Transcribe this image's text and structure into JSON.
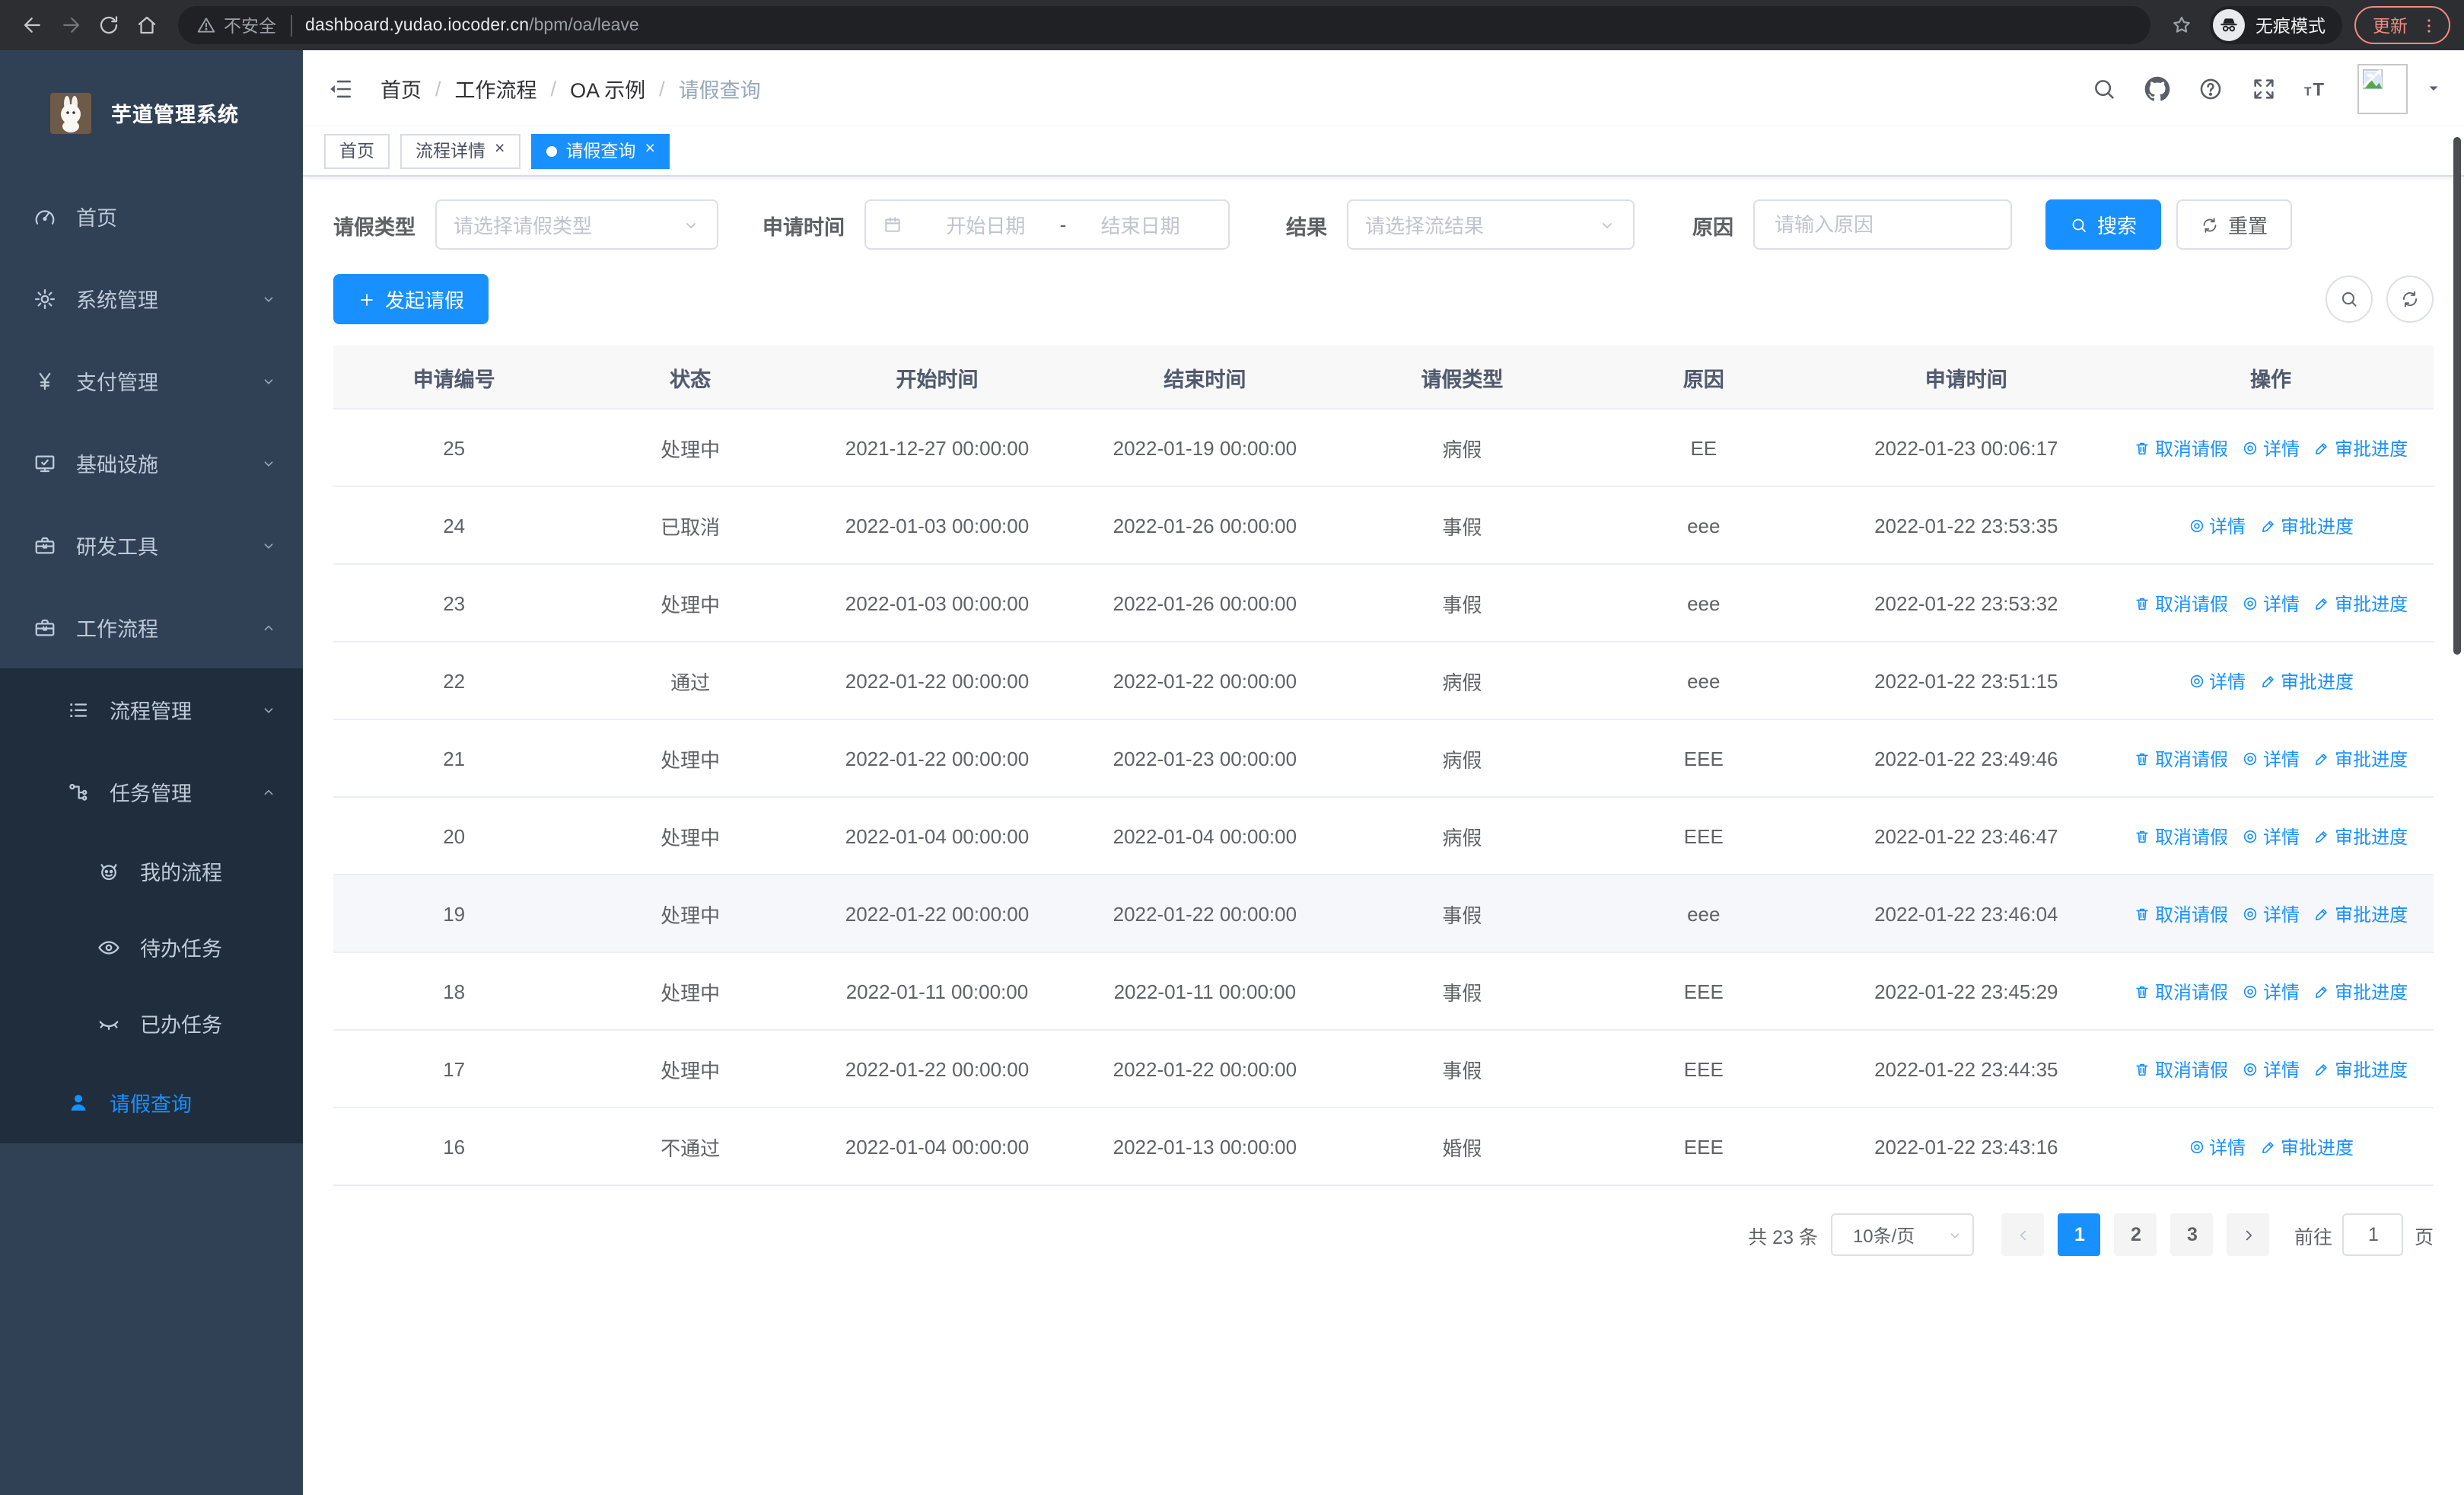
{
  "colors": {
    "primary": "#1890ff",
    "sidebar_bg": "#304156",
    "sidebar_submenu_bg": "#1f2d3d",
    "update_accent": "#f28b82"
  },
  "browser": {
    "security_label": "不安全",
    "url_host": "dashboard.yudao.iocoder.cn",
    "url_path": "/bpm/oa/leave",
    "incognito_label": "无痕模式",
    "update_label": "更新"
  },
  "sidebar": {
    "title": "芋道管理系统",
    "items": [
      {
        "label": "首页",
        "icon": "gauge",
        "level": 0
      },
      {
        "label": "系统管理",
        "icon": "gear",
        "level": 0,
        "chevron": "down"
      },
      {
        "label": "支付管理",
        "icon": "yen",
        "level": 0,
        "chevron": "down"
      },
      {
        "label": "基础设施",
        "icon": "monitor",
        "level": 0,
        "chevron": "down"
      },
      {
        "label": "研发工具",
        "icon": "toolbox",
        "level": 0,
        "chevron": "down"
      },
      {
        "label": "工作流程",
        "icon": "toolbox",
        "level": 0,
        "chevron": "up"
      },
      {
        "label": "流程管理",
        "icon": "list",
        "level": 1,
        "chevron": "down",
        "sub": true
      },
      {
        "label": "任务管理",
        "icon": "flow",
        "level": 1,
        "chevron": "up",
        "sub": true
      },
      {
        "label": "我的流程",
        "icon": "robot",
        "level": 2,
        "sub": true
      },
      {
        "label": "待办任务",
        "icon": "eye",
        "level": 2,
        "sub": true
      },
      {
        "label": "已办任务",
        "icon": "eye-closed",
        "level": 2,
        "sub": true
      },
      {
        "label": "请假查询",
        "icon": "user",
        "level": 1,
        "sub": true,
        "active": true
      }
    ]
  },
  "breadcrumb": [
    "首页",
    "工作流程",
    "OA 示例",
    "请假查询"
  ],
  "tabs": [
    {
      "label": "首页",
      "closable": false,
      "active": false
    },
    {
      "label": "流程详情",
      "closable": true,
      "active": false
    },
    {
      "label": "请假查询",
      "closable": true,
      "active": true
    }
  ],
  "filters": {
    "leave_type": {
      "label": "请假类型",
      "placeholder": "请选择请假类型"
    },
    "apply_time": {
      "label": "申请时间",
      "start_placeholder": "开始日期",
      "separator": "-",
      "end_placeholder": "结束日期"
    },
    "result": {
      "label": "结果",
      "placeholder": "请选择流结果"
    },
    "reason": {
      "label": "原因",
      "placeholder": "请输入原因"
    },
    "search_label": "搜索",
    "reset_label": "重置"
  },
  "toolbar": {
    "create_label": "发起请假"
  },
  "table": {
    "columns": [
      "申请编号",
      "状态",
      "开始时间",
      "结束时间",
      "请假类型",
      "原因",
      "申请时间",
      "操作"
    ],
    "action_labels": {
      "cancel": "取消请假",
      "detail": "详情",
      "progress": "审批进度"
    },
    "rows": [
      {
        "id": "25",
        "status": "处理中",
        "start": "2021-12-27 00:00:00",
        "end": "2022-01-19 00:00:00",
        "type": "病假",
        "reason": "EE",
        "apply": "2022-01-23 00:06:17",
        "actions": [
          "cancel",
          "detail",
          "progress"
        ],
        "highlight": false
      },
      {
        "id": "24",
        "status": "已取消",
        "start": "2022-01-03 00:00:00",
        "end": "2022-01-26 00:00:00",
        "type": "事假",
        "reason": "eee",
        "apply": "2022-01-22 23:53:35",
        "actions": [
          "detail",
          "progress"
        ],
        "highlight": false
      },
      {
        "id": "23",
        "status": "处理中",
        "start": "2022-01-03 00:00:00",
        "end": "2022-01-26 00:00:00",
        "type": "事假",
        "reason": "eee",
        "apply": "2022-01-22 23:53:32",
        "actions": [
          "cancel",
          "detail",
          "progress"
        ],
        "highlight": false
      },
      {
        "id": "22",
        "status": "通过",
        "start": "2022-01-22 00:00:00",
        "end": "2022-01-22 00:00:00",
        "type": "病假",
        "reason": "eee",
        "apply": "2022-01-22 23:51:15",
        "actions": [
          "detail",
          "progress"
        ],
        "highlight": false
      },
      {
        "id": "21",
        "status": "处理中",
        "start": "2022-01-22 00:00:00",
        "end": "2022-01-23 00:00:00",
        "type": "病假",
        "reason": "EEE",
        "apply": "2022-01-22 23:49:46",
        "actions": [
          "cancel",
          "detail",
          "progress"
        ],
        "highlight": false
      },
      {
        "id": "20",
        "status": "处理中",
        "start": "2022-01-04 00:00:00",
        "end": "2022-01-04 00:00:00",
        "type": "病假",
        "reason": "EEE",
        "apply": "2022-01-22 23:46:47",
        "actions": [
          "cancel",
          "detail",
          "progress"
        ],
        "highlight": false
      },
      {
        "id": "19",
        "status": "处理中",
        "start": "2022-01-22 00:00:00",
        "end": "2022-01-22 00:00:00",
        "type": "事假",
        "reason": "eee",
        "apply": "2022-01-22 23:46:04",
        "actions": [
          "cancel",
          "detail",
          "progress"
        ],
        "highlight": true
      },
      {
        "id": "18",
        "status": "处理中",
        "start": "2022-01-11 00:00:00",
        "end": "2022-01-11 00:00:00",
        "type": "事假",
        "reason": "EEE",
        "apply": "2022-01-22 23:45:29",
        "actions": [
          "cancel",
          "detail",
          "progress"
        ],
        "highlight": false
      },
      {
        "id": "17",
        "status": "处理中",
        "start": "2022-01-22 00:00:00",
        "end": "2022-01-22 00:00:00",
        "type": "事假",
        "reason": "EEE",
        "apply": "2022-01-22 23:44:35",
        "actions": [
          "cancel",
          "detail",
          "progress"
        ],
        "highlight": false
      },
      {
        "id": "16",
        "status": "不通过",
        "start": "2022-01-04 00:00:00",
        "end": "2022-01-13 00:00:00",
        "type": "婚假",
        "reason": "EEE",
        "apply": "2022-01-22 23:43:16",
        "actions": [
          "detail",
          "progress"
        ],
        "highlight": false
      }
    ]
  },
  "pagination": {
    "total_label": "共 23 条",
    "page_size": "10条/页",
    "pages": [
      "1",
      "2",
      "3"
    ],
    "active_page": "1",
    "goto_label": "前往",
    "goto_value": "1",
    "page_suffix": "页"
  }
}
